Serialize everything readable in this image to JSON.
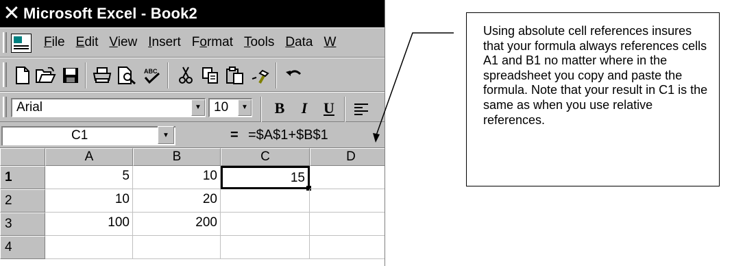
{
  "window": {
    "app_icon": "excel-x-icon",
    "title": "Microsoft Excel - Book2"
  },
  "menu": [
    "File",
    "Edit",
    "View",
    "Insert",
    "Format",
    "Tools",
    "Data",
    "W"
  ],
  "menu_underline": [
    "F",
    "E",
    "V",
    "I",
    "o",
    "T",
    "D",
    "W"
  ],
  "toolbar_icons": [
    "new-icon",
    "open-icon",
    "save-icon",
    "print-icon",
    "print-preview-icon",
    "spelling-icon",
    "cut-icon",
    "copy-icon",
    "paste-icon",
    "format-painter-icon",
    "undo-icon"
  ],
  "format_bar": {
    "font": "Arial",
    "size": "10",
    "bold": "B",
    "italic": "I",
    "underline": "U"
  },
  "formula_bar": {
    "name_box": "C1",
    "equals": "=",
    "formula": "=$A$1+$B$1"
  },
  "grid": {
    "columns": [
      "A",
      "B",
      "C",
      "D"
    ],
    "rows": [
      {
        "header": "1",
        "cells": [
          "5",
          "10",
          "15",
          ""
        ]
      },
      {
        "header": "2",
        "cells": [
          "10",
          "20",
          "",
          ""
        ]
      },
      {
        "header": "3",
        "cells": [
          "100",
          "200",
          "",
          ""
        ]
      },
      {
        "header": "4",
        "cells": [
          "",
          "",
          "",
          ""
        ]
      }
    ],
    "active_cell": "C1"
  },
  "callout": {
    "text": "Using absolute cell references insures that your formula always references cells A1 and B1 no matter where in the spreadsheet you copy and paste the formula. Note that your result in C1 is the same as when you use relative references."
  }
}
